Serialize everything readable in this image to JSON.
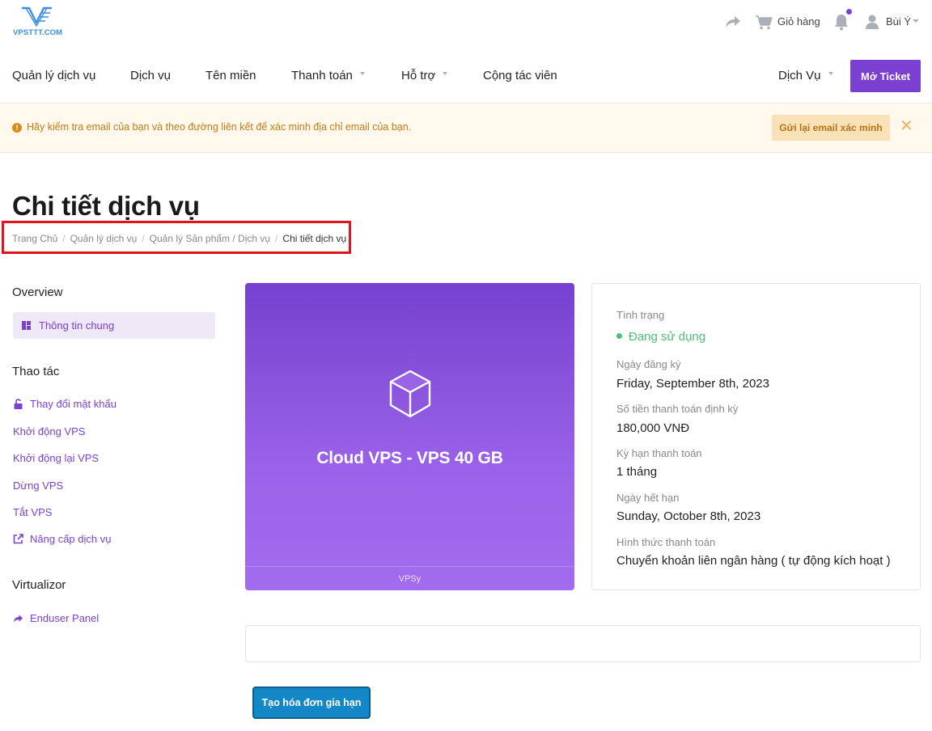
{
  "brand": {
    "logo_text": "VPSTTT.COM",
    "accent": "#7b3fd1"
  },
  "topbar": {
    "cart_label": "Giỏ hàng",
    "user_name": "Bùi Ý",
    "icons": [
      "share-icon",
      "cart-icon",
      "bell-icon",
      "user-icon"
    ]
  },
  "nav": {
    "items": [
      "Quản lý dịch vụ",
      "Dịch vụ",
      "Tên miền",
      "Thanh toán",
      "Hỗ trợ",
      "Cộng tác viên"
    ],
    "right_menu": "Dịch Vụ",
    "ticket_button": "Mở Ticket"
  },
  "alert": {
    "text": "Hãy kiểm tra email của bạn và theo đường liên kết để xác minh địa chỉ email của bạn.",
    "button": "Gửi lại email xác minh",
    "close": "✕"
  },
  "page": {
    "title": "Chi tiết dịch vụ",
    "breadcrumb": [
      "Trang Chủ",
      "Quản lý dịch vụ",
      "Quản lý Sản phẩm / Dịch vụ",
      "Chi tiết dịch vụ"
    ]
  },
  "sidebar": {
    "overview_heading": "Overview",
    "overview_item": "Thông tin chung",
    "actions_heading": "Thao tác",
    "actions": [
      "Thay đổi mật khẩu",
      "Khởi động VPS",
      "Khởi động lại VPS",
      "Dừng VPS",
      "Tắt VPS",
      "Nâng cấp dịch vụ"
    ],
    "virtualizor_heading": "Virtualizor",
    "virtualizor_item": "Enduser Panel"
  },
  "product": {
    "name": "Cloud VPS - VPS 40 GB",
    "footer": "VPSy"
  },
  "info": {
    "status_label": "Tình trạng",
    "status_value": "Đang sử dụng",
    "reg_date_label": "Ngày đăng ký",
    "reg_date_value": "Friday, September 8th, 2023",
    "amount_label": "Số tiền thanh toán định kỳ",
    "amount_value": "180,000 VNĐ",
    "cycle_label": "Kỳ hạn thanh toán",
    "cycle_value": "1 tháng",
    "due_label": "Ngày hết hạn",
    "due_value": "Sunday, October 8th, 2023",
    "method_label": "Hình thức thanh toán",
    "method_value": "Chuyển khoản liên ngân hàng ( tự động kích hoạt )"
  },
  "renew_button": "Tạo hóa đơn gia hạn"
}
